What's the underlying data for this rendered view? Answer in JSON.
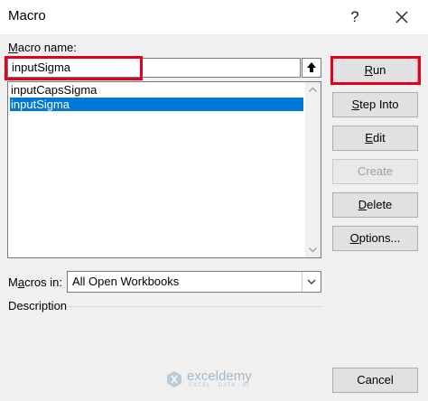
{
  "window": {
    "title": "Macro",
    "help_glyph": "?"
  },
  "macro_name": {
    "label_prefix": "",
    "label_accel": "M",
    "label_rest": "acro name:",
    "value": "inputSigma"
  },
  "macro_list": {
    "items": [
      {
        "label": "inputCapsSigma",
        "selected": false
      },
      {
        "label": "inputSigma",
        "selected": true
      }
    ]
  },
  "buttons": {
    "run": {
      "prefix": "",
      "accel": "R",
      "rest": "un",
      "disabled": false
    },
    "step": {
      "prefix": "",
      "accel": "S",
      "rest": "tep Into",
      "disabled": false
    },
    "edit": {
      "prefix": "",
      "accel": "E",
      "rest": "dit",
      "disabled": false
    },
    "create": {
      "prefix": "",
      "accel": "",
      "rest": "Create",
      "disabled": true
    },
    "delete": {
      "prefix": "",
      "accel": "D",
      "rest": "elete",
      "disabled": false
    },
    "options": {
      "prefix": "",
      "accel": "O",
      "rest": "ptions...",
      "disabled": false
    },
    "cancel": {
      "label": "Cancel"
    }
  },
  "macros_in": {
    "label_prefix": "M",
    "label_accel": "a",
    "label_rest": "cros in:",
    "value": "All Open Workbooks"
  },
  "description": {
    "label": "Description"
  },
  "watermark": {
    "name": "exceldemy",
    "tagline": "EXCEL · DATA · BI"
  },
  "colors": {
    "highlight": "#e2001a",
    "selection": "#0078d7"
  }
}
